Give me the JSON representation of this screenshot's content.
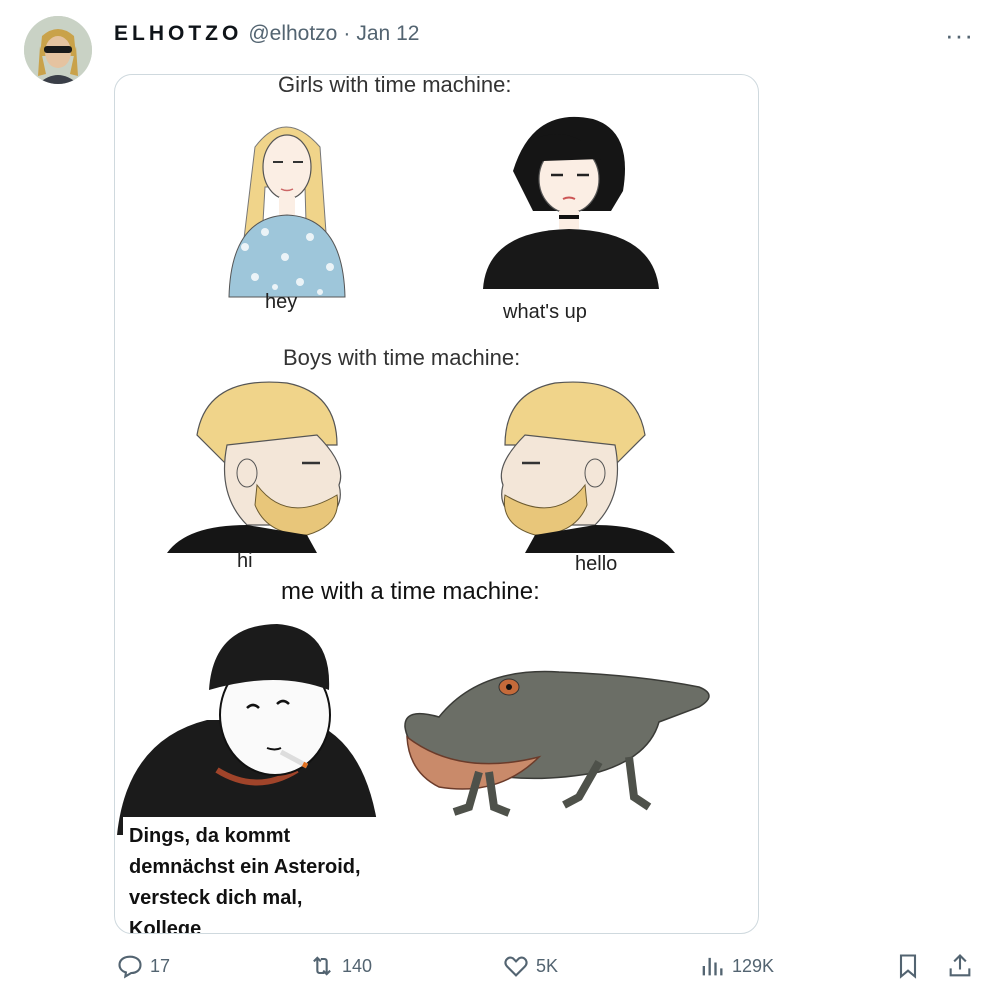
{
  "tweet": {
    "display_name": "ELHOTZO",
    "handle": "@elhotzo",
    "separator": "·",
    "date": "Jan 12",
    "more": "···"
  },
  "meme": {
    "girls_header": "Girls with time machine:",
    "girl1_label": "hey",
    "girl2_label": "what's up",
    "boys_header": "Boys with time machine:",
    "boy1_label": "hi",
    "boy2_label": "hello",
    "me_header": "me with a time machine:",
    "caption_lines": [
      "Dings, da kommt",
      "demnächst ein Asteroid,",
      "versteck dich mal,",
      "Kollege"
    ]
  },
  "actions": {
    "replies": "17",
    "reposts": "140",
    "likes": "5K",
    "views": "129K"
  },
  "colors": {
    "muted": "#536471",
    "border": "#cfd9de",
    "hair_blonde": "#f0d48a",
    "beard": "#e8c67a",
    "black": "#1b1b1b",
    "amphibian": "#6b6e66"
  },
  "icons": [
    "reply-icon",
    "repost-icon",
    "like-icon",
    "views-icon",
    "bookmark-icon",
    "share-icon",
    "more-icon"
  ]
}
